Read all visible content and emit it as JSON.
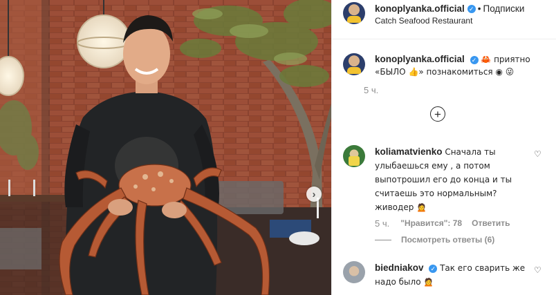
{
  "post": {
    "username": "konoplyanka.official",
    "follow_separator": "•",
    "follow_label": "Подписки",
    "location": "Catch Seafood Restaurant",
    "caption_text": "🦀 приятно «БЫЛО 👍» познакомиться ◉ 😜",
    "caption_time": "5 ч."
  },
  "comments": [
    {
      "username": "koliamatvienko",
      "text": "Сначала ты улыбаешься ему , а потом выпотрошил его до конца и ты считаешь это нормальным? живодер 🙍",
      "time": "5 ч.",
      "likes": "\"Нравится\": 78",
      "reply_label": "Ответить",
      "view_replies": "Посмотреть ответы (6)"
    },
    {
      "username": "biedniakov",
      "text": "Так его сварить же надо было 🙍"
    }
  ],
  "icons": {
    "verified": "verified-badge-icon",
    "plus": "plus-circle-icon",
    "heart": "heart-outline-icon",
    "next": "chevron-right-icon"
  },
  "colors": {
    "verified_blue": "#3897f0",
    "muted_text": "#8e8e8e",
    "brick": "#8a4330"
  }
}
